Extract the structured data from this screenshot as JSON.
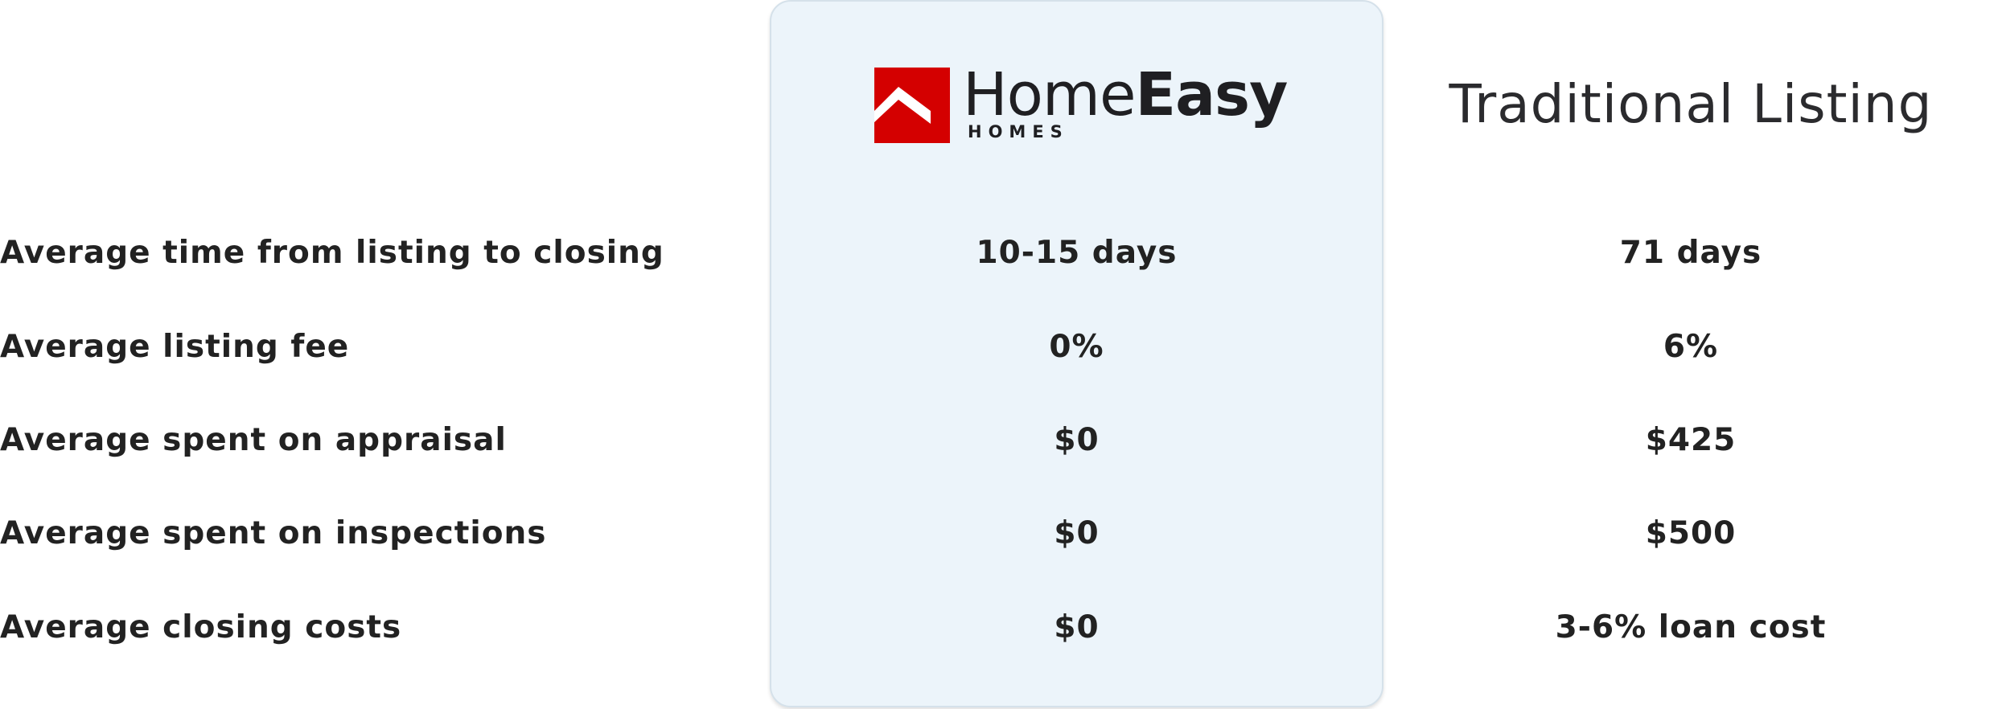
{
  "brand": {
    "word_light": "Home",
    "word_bold": "Easy",
    "sub": "HOMES",
    "color": "#d40000"
  },
  "columns": {
    "traditional": "Traditional Listing"
  },
  "rows": [
    {
      "label": "Average time from listing to closing",
      "homeeasy": "10-15 days",
      "traditional": "71 days"
    },
    {
      "label": "Average listing fee",
      "homeeasy": "0%",
      "traditional": "6%"
    },
    {
      "label": "Average spent on appraisal",
      "homeeasy": "$0",
      "traditional": "$425"
    },
    {
      "label": "Average spent on inspections",
      "homeeasy": "$0",
      "traditional": "$500"
    },
    {
      "label": "Average closing costs",
      "homeeasy": "$0",
      "traditional": "3-6% loan cost"
    }
  ],
  "colors": {
    "card_background": "#ecf4fa",
    "text": "#222222"
  }
}
